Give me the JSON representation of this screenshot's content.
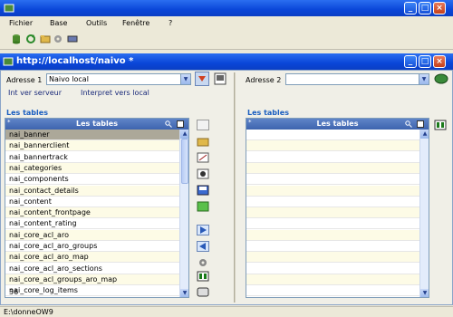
{
  "menubar": {
    "items": [
      "Fichier",
      "Base",
      "Outils",
      "Fenêtre",
      "?"
    ]
  },
  "inner_window": {
    "title": "http://localhost/naivo *"
  },
  "left": {
    "address_label": "Adresse 1",
    "address_value": "Naivo local",
    "link_server": "Int ver serveur",
    "link_interpret": "Interpret vers local",
    "section_title": "Les tables",
    "table_header": "Les tables",
    "rows": [
      "nai_banner",
      "nai_bannerclient",
      "nai_bannertrack",
      "nai_categories",
      "nai_components",
      "nai_contact_details",
      "nai_content",
      "nai_content_frontpage",
      "nai_content_rating",
      "nai_core_acl_aro",
      "nai_core_acl_aro_groups",
      "nai_core_acl_aro_map",
      "nai_core_acl_aro_sections",
      "nai_core_acl_groups_aro_map",
      "nai_core_log_items"
    ],
    "count": "36"
  },
  "right": {
    "address_label": "Adresse 2",
    "address_value": "",
    "section_title": "Les tables",
    "table_header": "Les tables"
  },
  "status": {
    "text": "E:\\donneOW9"
  },
  "colors": {
    "title_bar": "#0a46d8",
    "accent": "#1a5ec0",
    "selection": "#aca899"
  }
}
